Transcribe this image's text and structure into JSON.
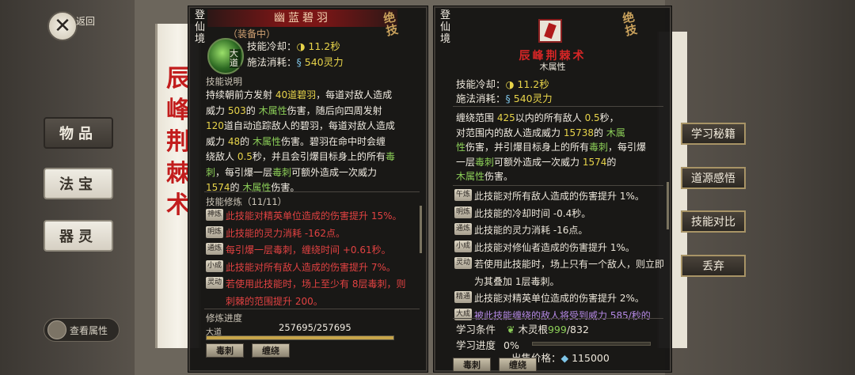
{
  "nav": {
    "back_label": "返回",
    "side_buttons": [
      "物品",
      "法宝",
      "器灵"
    ],
    "view_attr_label": "查看属性"
  },
  "scroll": {
    "chars": [
      "辰",
      "峰",
      "荆",
      "棘",
      "术"
    ]
  },
  "left_panel": {
    "realm": "登仙境",
    "title": "幽蓝碧羽",
    "equipped_label": "（装备中）",
    "badge": "绝技",
    "skill_tag": "大道",
    "cooldown_label": "技能冷却：",
    "cooldown_value": "11.2秒",
    "cost_label": "施法消耗：",
    "cost_value": "540灵力",
    "desc_label": "技能说明",
    "desc_lines": [
      [
        "持续朝前方发射 ",
        "40道碧羽",
        "，每道对敌人造成"
      ],
      [
        "威力 ",
        "503",
        "的 ",
        "木属性",
        "伤害，随后向四周发射"
      ],
      [
        "",
        "120",
        "道自动追踪敌人的碧羽，每道对敌人造成"
      ],
      [
        "威力 ",
        "48",
        "的 ",
        "木属性",
        "伤害。碧羽在命中时会缠"
      ],
      [
        "绕敌人 ",
        "0.5",
        "秒，并且会引爆目标身上的所有",
        "毒"
      ],
      [
        "刺",
        "，每引爆一层",
        "毒刺",
        "可额外造成一次威力"
      ],
      [
        "",
        "1574",
        "的 ",
        "木属性",
        "伤害。"
      ]
    ],
    "mod_label": "技能修炼（11/11）",
    "mods": [
      {
        "tag": "神炼",
        "text": "此技能对精英单位造成的伤害提升 15%。"
      },
      {
        "tag": "明炼",
        "text": "此技能的灵力消耗 -162点。"
      },
      {
        "tag": "通炼",
        "text": "每引爆一层毒刺，缠绕时间 +0.61秒。"
      },
      {
        "tag": "小成",
        "text": "此技能对所有敌人造成的伤害提升 7%。"
      },
      {
        "tag": "灵动",
        "text": "若使用此技能时，场上至少有 8层毒刺，则"
      },
      {
        "tag": "",
        "text": "刺棘的范围提升 200。"
      }
    ],
    "progress_label": "修炼进度",
    "progress_tag": "大道",
    "progress_text": "257695/257695",
    "progress_fraction": 1.0,
    "buttons": [
      "毒刺",
      "缠绕"
    ]
  },
  "right_panel": {
    "realm": "登仙境",
    "title": "辰峰荆棘术",
    "subtitle": "木属性",
    "badge": "绝技",
    "cooldown_label": "技能冷却：",
    "cooldown_value": "11.2秒",
    "cost_label": "施法消耗：",
    "cost_value": "540灵力",
    "desc_lines": [
      [
        "缠绕范围 ",
        "425",
        "以内的所有敌人 ",
        "0.5",
        "秒，"
      ],
      [
        "对范围内的敌人造成威力 ",
        "15738",
        "的 ",
        "木属"
      ],
      [
        "性",
        "伤害，并引爆目标身上的所有",
        "毒刺",
        "，每引爆"
      ],
      [
        "一层",
        "毒刺",
        "可额外造成一次威力 ",
        "1574",
        "的"
      ],
      [
        "",
        "木属性",
        "伤害。"
      ]
    ],
    "mods": [
      {
        "tag": "午炼",
        "text": "此技能对所有敌人造成的伤害提升 1%。",
        "style": "normal"
      },
      {
        "tag": "明炼",
        "text": "此技能的冷却时间 -0.4秒。",
        "style": "normal"
      },
      {
        "tag": "通炼",
        "text": "此技能的灵力消耗 -16点。",
        "style": "normal"
      },
      {
        "tag": "小成",
        "text": "此技能对修仙者造成的伤害提升 1%。",
        "style": "normal"
      },
      {
        "tag": "灵动",
        "text": "若使用此技能时，场上只有一个敌人，则立即",
        "style": "normal"
      },
      {
        "tag": "",
        "text": "为其叠加 1层毒刺。",
        "style": "normal"
      },
      {
        "tag": "精通",
        "text": "此技能对精英单位造成的伤害提升 2%。",
        "style": "normal"
      },
      {
        "tag": "大成",
        "text": "被此技能缠绕的敌人将受到威力 585/秒的",
        "style": "purple"
      }
    ],
    "learn_cond_label": "学习条件",
    "learn_cond_value": "木灵根",
    "learn_cond_have": "999",
    "learn_cond_need": "/832",
    "learn_progress_label": "学习进度",
    "learn_progress_value": "0%",
    "learn_progress_fraction": 0.0,
    "price_label": "出售价格：",
    "price_value": "115000",
    "buttons": [
      "毒刺",
      "缠绕"
    ]
  },
  "actions": [
    "学习秘籍",
    "道源感悟",
    "技能对比",
    "丢弃"
  ]
}
